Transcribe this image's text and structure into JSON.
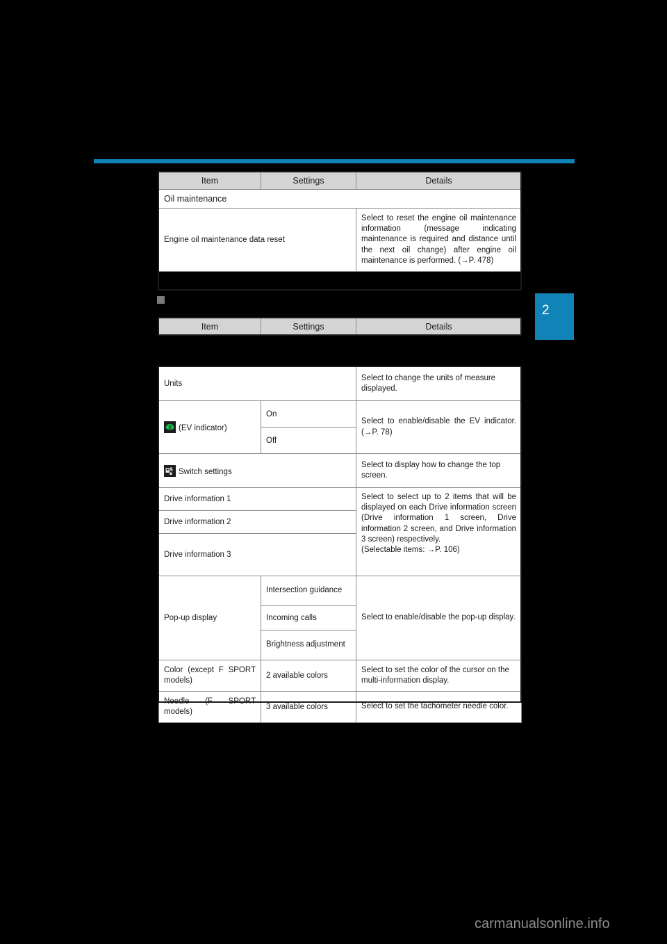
{
  "page": {
    "background_color": "#000000",
    "accent_color": "#1183B6",
    "chapter_tab": "2",
    "watermark": "carmanualsonline.info"
  },
  "section_heading": "",
  "columns": {
    "item": "Item",
    "settings": "Settings",
    "details": "Details"
  },
  "oil_table": {
    "header": {
      "item": "Item",
      "settings": "Settings",
      "details": "Details"
    },
    "group_label": "Oil maintenance",
    "rows": [
      {
        "item": "Engine oil maintenance data reset",
        "settings": "",
        "details": "Select to reset the engine oil maintenance information (message indicating maintenance is required and distance until the next oil change) after engine oil maintenance is performed. (→P. 478)"
      }
    ]
  },
  "second_header": {
    "item": "Item",
    "settings": "Settings",
    "details": "Details"
  },
  "main_table": {
    "rows": [
      {
        "item": "Units",
        "icon": "",
        "settings": [],
        "details": "Select to change the units of measure displayed."
      },
      {
        "item": "(EV indicator)",
        "icon": "ev-indicator-icon",
        "settings": [
          "On",
          "Off"
        ],
        "details": "Select to enable/disable the EV indicator. (→P. 78)"
      },
      {
        "item": "Switch settings",
        "icon": "switch-settings-icon",
        "settings": [],
        "details": "Select to display how to change the top screen."
      },
      {
        "item": "Drive information 1",
        "icon": "",
        "settings": [],
        "details": "Select to select up to 2 items that will be displayed on each Drive information screen (Drive information 1 screen, Drive information 2 screen, and Drive information 3 screen) respectively.\n(Selectable items: →P. 106)"
      },
      {
        "item": "Drive information 2",
        "icon": "",
        "settings": [],
        "details": ""
      },
      {
        "item": "Drive information 3",
        "icon": "",
        "settings": [],
        "details": ""
      },
      {
        "item": "Pop-up display",
        "icon": "",
        "settings": [
          "Intersection guidance",
          "Incoming calls",
          "Brightness adjustment"
        ],
        "details": "Select to enable/disable the pop-up display."
      },
      {
        "item": "Color (except F SPORT models)",
        "icon": "",
        "settings": [
          "2 available colors"
        ],
        "details": "Select to set the color of the cursor on the multi-information display."
      },
      {
        "item": "Needle (F SPORT models)",
        "icon": "",
        "settings": [
          "3 available colors"
        ],
        "details": "Select to set the tachometer needle color."
      }
    ]
  },
  "text": {
    "oil_details": "Select to reset the engine oil maintenance information (message indicating maintenance is required and distance until the next oil change) after engine oil maintenance is performed. (→P. 478)",
    "units_details": "Select to change the units of measure displayed.",
    "ev_details": "Select to enable/disable the EV indicator. (→P. 78)",
    "switch_details": "Select to display how to change the top screen.",
    "drive_details_main": "Select to select up to 2 items that will be displayed on each Drive information screen (Drive information 1 screen, Drive information 2 screen, and Drive information 3 screen) respectively.",
    "drive_details_sub": "(Selectable items: →P. 106)",
    "popup_details": "Select to enable/disable the pop-up display.",
    "color_details": "Select to set the color of the cursor on the multi-information display.",
    "needle_details": "Select to set the tachometer needle color.",
    "oil_group": "Oil maintenance",
    "oil_item": "Engine oil maintenance data reset",
    "units": "Units",
    "ev_label": "(EV indicator)",
    "ev_on": "On",
    "ev_off": "Off",
    "switch_label": "Switch settings",
    "drive1": "Drive information 1",
    "drive2": "Drive information 2",
    "drive3": "Drive information 3",
    "popup_label": "Pop-up display",
    "popup_s1": "Intersection guidance",
    "popup_s2": "Incoming calls",
    "popup_s3": "Brightness adjustment",
    "color_label": "Color (except F SPORT models)",
    "color_settings": "2 available colors",
    "needle_label": "Needle (F SPORT models)",
    "needle_settings": "3 available colors"
  }
}
